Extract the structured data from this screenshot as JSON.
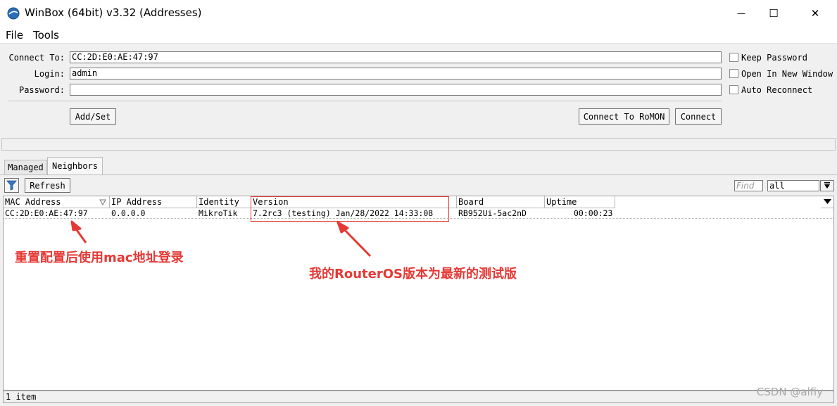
{
  "window": {
    "title": "WinBox (64bit) v3.32 (Addresses)",
    "minimize_glyph": "—",
    "maximize_glyph": "☐",
    "close_glyph": "✕"
  },
  "menu": {
    "file": "File",
    "tools": "Tools"
  },
  "form": {
    "connect_to_label": "Connect To:",
    "connect_to_value": "CC:2D:E0:AE:47:97",
    "login_label": "Login:",
    "login_value": "admin",
    "password_label": "Password:",
    "password_value": "",
    "keep_password": "Keep Password",
    "open_new_window": "Open In New Window",
    "auto_reconnect": "Auto Reconnect",
    "add_set": "Add/Set",
    "connect_romon": "Connect To RoMON",
    "connect": "Connect"
  },
  "tabs": {
    "managed": "Managed",
    "neighbors": "Neighbors"
  },
  "toolbar": {
    "refresh": "Refresh",
    "find_placeholder": "Find",
    "filter_value": "all"
  },
  "table": {
    "columns": [
      "MAC Address",
      "IP Address",
      "Identity",
      "Version",
      "Board",
      "Uptime"
    ],
    "rows": [
      {
        "mac": "CC:2D:E0:AE:47:97",
        "ip": "0.0.0.0",
        "identity": "MikroTik",
        "version": "7.2rc3 (testing) Jan/28/2022 14:33:08",
        "board": "RB952Ui-5ac2nD",
        "uptime": "00:00:23"
      }
    ]
  },
  "annotations": {
    "mac_note": "重置配置后使用mac地址登录",
    "version_note": "我的RouterOS版本为最新的测试版",
    "color": "#e53935"
  },
  "status": {
    "count": "1 item"
  },
  "watermark": "CSDN @alfiy"
}
